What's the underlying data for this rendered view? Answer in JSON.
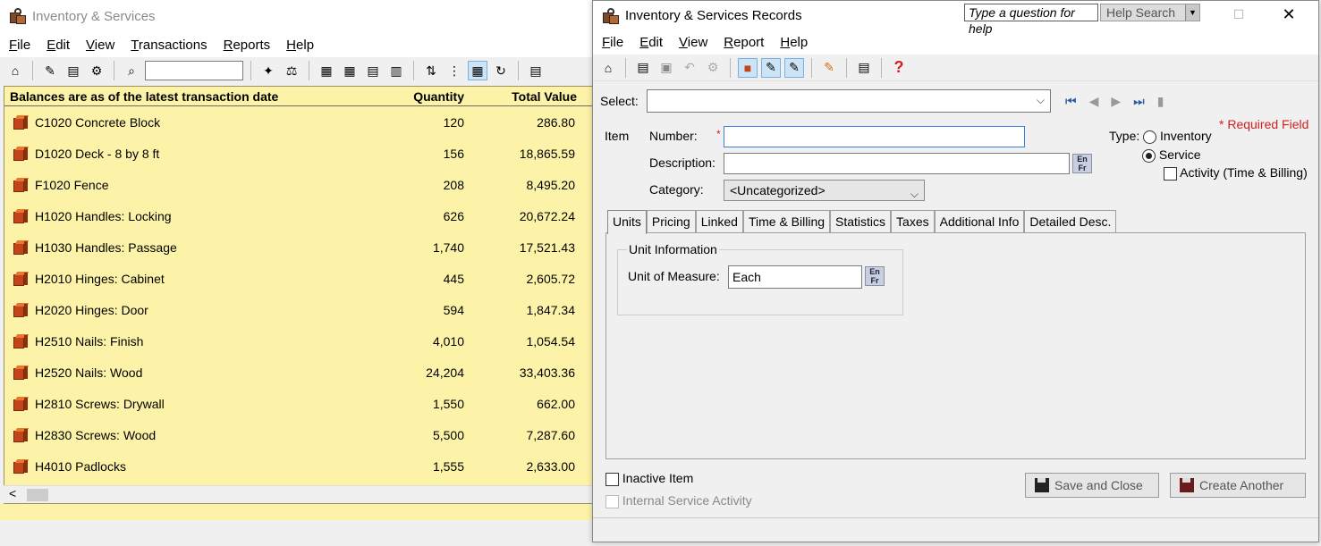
{
  "back_window": {
    "title": "Inventory & Services",
    "menu": [
      "File",
      "Edit",
      "View",
      "Transactions",
      "Reports",
      "Help"
    ],
    "header": {
      "description": "Balances are as of the latest transaction date",
      "quantity": "Quantity",
      "total_value": "Total Value"
    },
    "rows": [
      {
        "name": "C1020 Concrete Block",
        "qty": "120",
        "value": "286.80"
      },
      {
        "name": "D1020 Deck - 8 by 8 ft",
        "qty": "156",
        "value": "18,865.59"
      },
      {
        "name": "F1020 Fence",
        "qty": "208",
        "value": "8,495.20"
      },
      {
        "name": "H1020 Handles: Locking",
        "qty": "626",
        "value": "20,672.24"
      },
      {
        "name": "H1030 Handles: Passage",
        "qty": "1,740",
        "value": "17,521.43"
      },
      {
        "name": "H2010 Hinges: Cabinet",
        "qty": "445",
        "value": "2,605.72"
      },
      {
        "name": "H2020 Hinges: Door",
        "qty": "594",
        "value": "1,847.34"
      },
      {
        "name": "H2510 Nails: Finish",
        "qty": "4,010",
        "value": "1,054.54"
      },
      {
        "name": "H2520 Nails: Wood",
        "qty": "24,204",
        "value": "33,403.36"
      },
      {
        "name": "H2810 Screws: Drywall",
        "qty": "1,550",
        "value": "662.00"
      },
      {
        "name": "H2830 Screws: Wood",
        "qty": "5,500",
        "value": "7,287.60"
      },
      {
        "name": "H4010 Padlocks",
        "qty": "1,555",
        "value": "2,633.00"
      }
    ]
  },
  "front_window": {
    "title": "Inventory & Services Records",
    "help_question": "Type a question for help",
    "help_search": "Help Search",
    "menu": [
      "File",
      "Edit",
      "View",
      "Report",
      "Help"
    ],
    "select_label": "Select:",
    "required_note": "* Required Field",
    "item_label": "Item",
    "number_label": "Number:",
    "description_label": "Description:",
    "category_label": "Category:",
    "category_value": "<Uncategorized>",
    "type_label": "Type:",
    "type_inventory": "Inventory",
    "type_service": "Service",
    "activity_label": "Activity (Time & Billing)",
    "lang_en": "En",
    "lang_fr": "Fr",
    "tabs": [
      "Units",
      "Pricing",
      "Linked",
      "Time & Billing",
      "Statistics",
      "Taxes",
      "Additional Info",
      "Detailed Desc."
    ],
    "unit_info_title": "Unit Information",
    "unit_of_measure_label": "Unit of Measure:",
    "unit_of_measure_value": "Each",
    "inactive_item": "Inactive Item",
    "internal_service": "Internal Service Activity",
    "save_close": "Save and Close",
    "create_another": "Create Another"
  },
  "colors": {
    "list_background": "#fdf3a8",
    "required": "#d02020",
    "focus": "#3c7fd6"
  }
}
